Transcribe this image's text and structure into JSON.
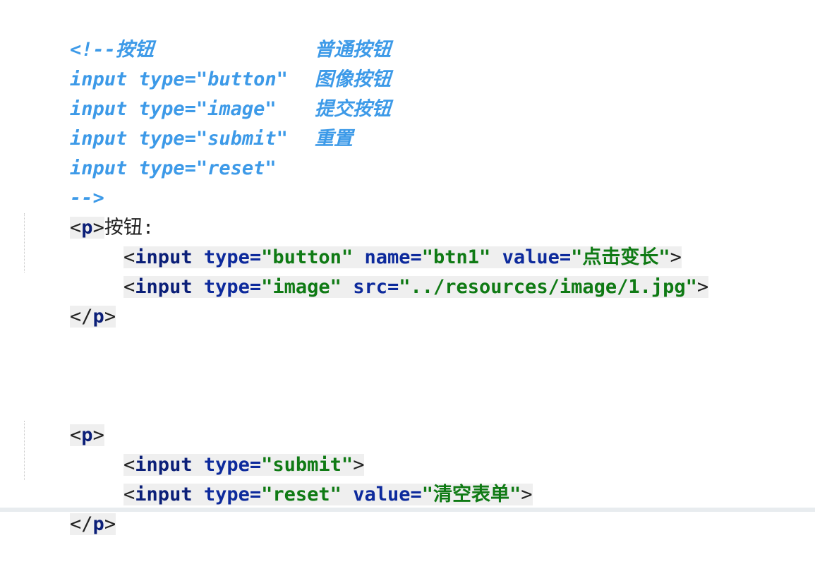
{
  "comment_block": {
    "open": "<!--按钮",
    "lines": [
      {
        "code": "input type=\"button\"",
        "desc": "普通按钮"
      },
      {
        "code": "input type=\"image\"",
        "desc": "图像按钮"
      },
      {
        "code": "input type=\"submit\"",
        "desc": "提交按钮"
      },
      {
        "code": "input type=\"reset\"",
        "desc": "重置"
      }
    ],
    "close": "-->"
  },
  "markup": {
    "lt": "<",
    "gt": ">",
    "lt_slash": "</",
    "p_tag": "p",
    "input_tag": "input",
    "space": " ",
    "eq": "=",
    "p1_text": "按钮:",
    "type_attr": "type",
    "name_attr": "name",
    "value_attr": "value",
    "src_attr": "src",
    "v_button": "\"button\"",
    "v_btn1": "\"btn1\"",
    "v_dianjibianchang": "\"点击变长\"",
    "v_image": "\"image\"",
    "v_src": "\"../resources/image/1.jpg\"",
    "v_submit": "\"submit\"",
    "v_reset": "\"reset\"",
    "v_qingkong": "\"清空表单\""
  }
}
